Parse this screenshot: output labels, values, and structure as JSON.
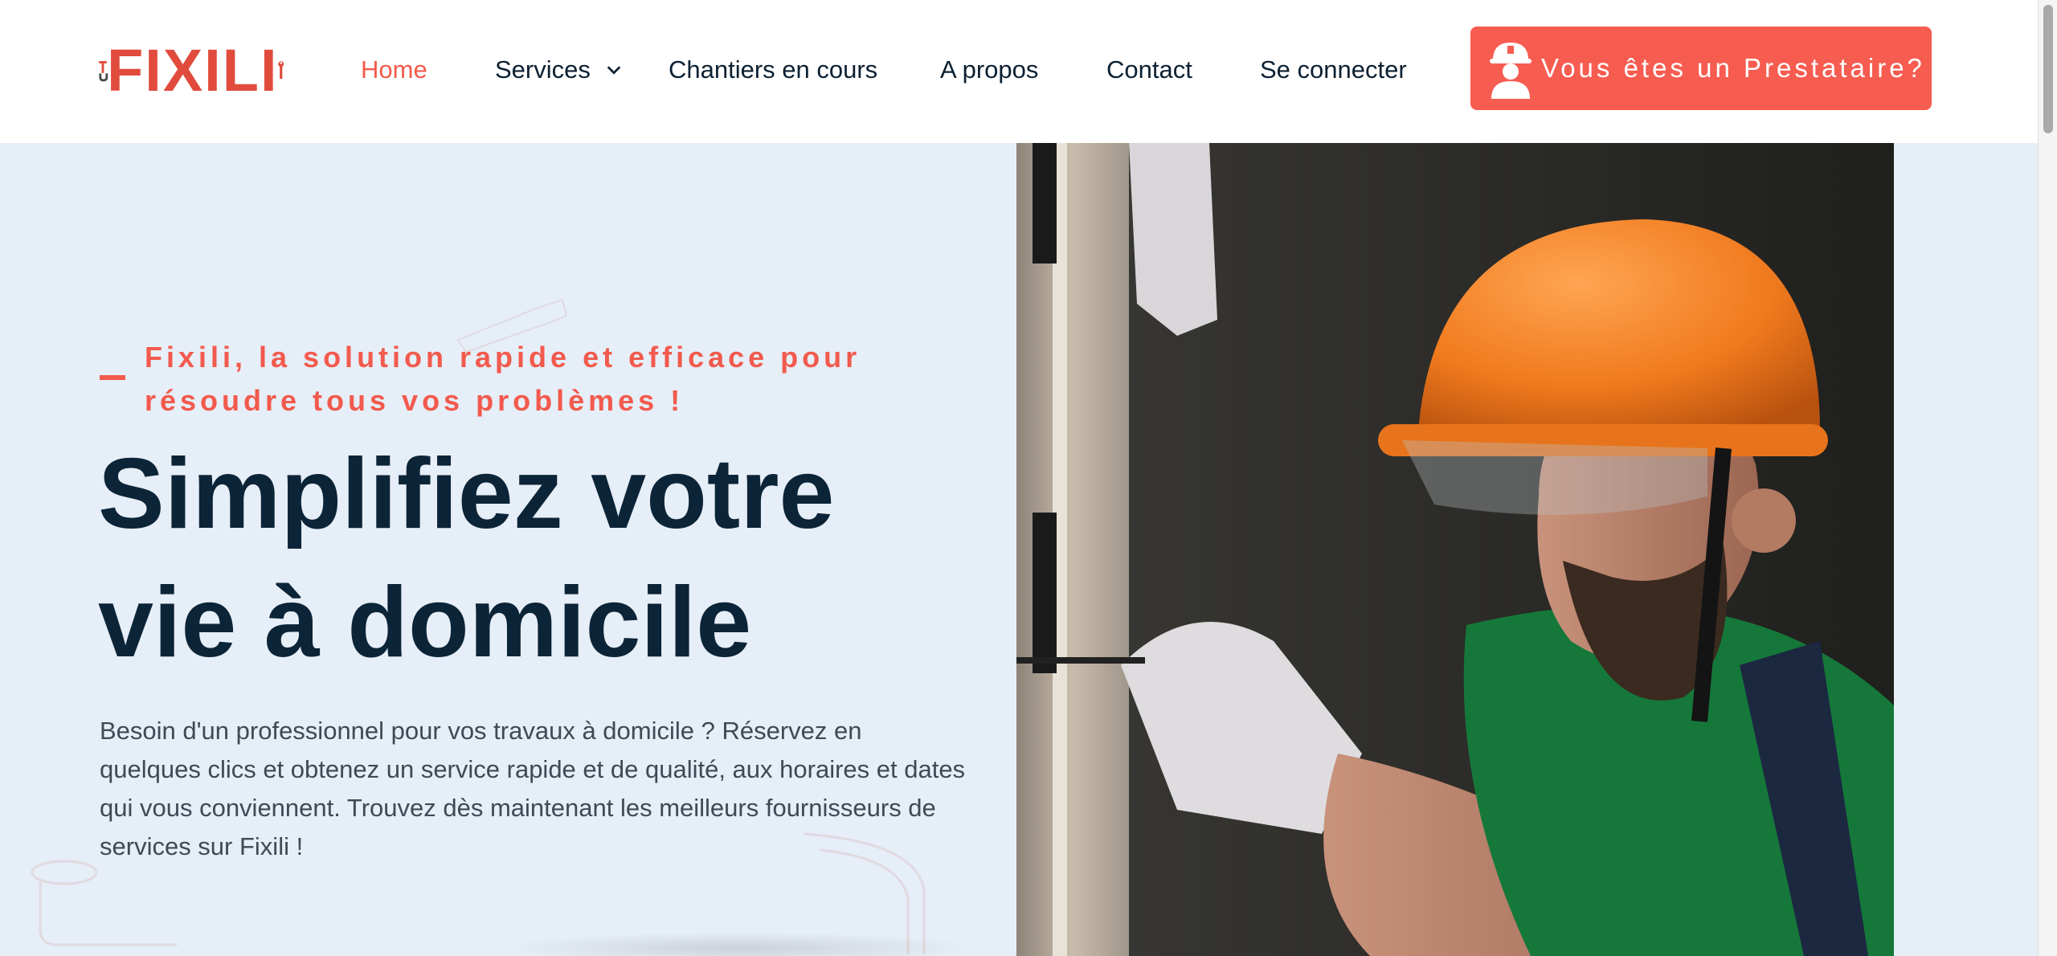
{
  "brand": {
    "name": "FIXILI",
    "accent": "#f25a4d",
    "logo_color": "#e14b3d"
  },
  "nav": {
    "home": "Home",
    "services": "Services",
    "chantiers": "Chantiers en cours",
    "apropos": "A propos",
    "contact": "Contact",
    "login": "Se connecter",
    "active": "Home"
  },
  "cta": {
    "label": "Vous êtes un Prestataire?",
    "icon": "worker-icon",
    "color": "#f75c50"
  },
  "hero": {
    "tagline": "Fixili, la solution rapide et efficace pour résoudre tous vos problèmes !",
    "headline_line1": "Simplifiez votre",
    "headline_line2": "vie à domicile",
    "description": "Besoin d'un professionnel pour vos travaux à domicile ? Réservez en quelques clics et obtenez un service rapide et de qualité, aux horaires et dates qui vous conviennent. Trouvez dès maintenant les meilleurs fournisseurs de services sur Fixili !",
    "image": "worker-with-orange-helmet-photo"
  },
  "colors": {
    "hero_bg": "#e6eef7",
    "heading": "#0c2437",
    "body_text": "#3f4a55",
    "nav_text": "#0c2032"
  }
}
